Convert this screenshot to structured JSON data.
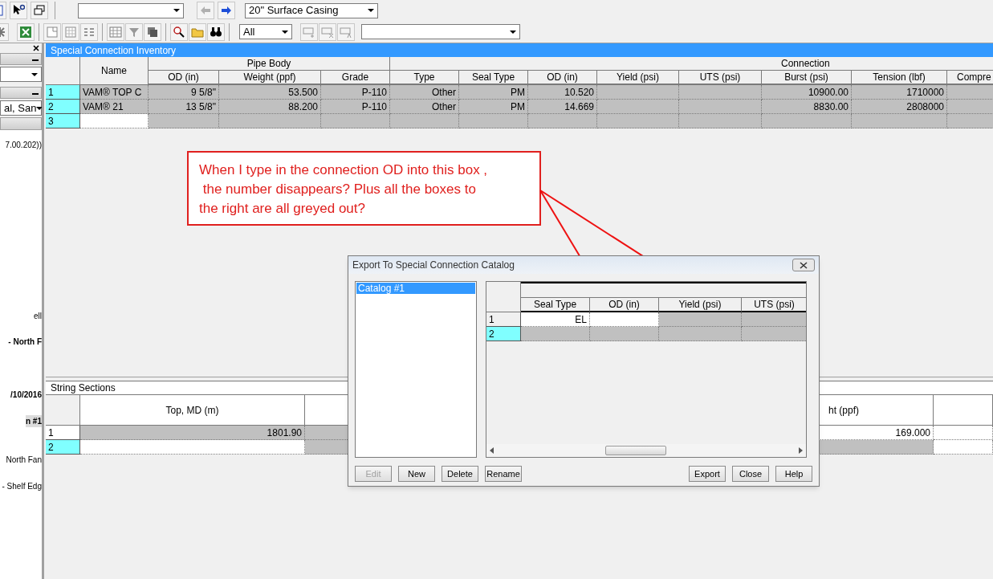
{
  "toolbar": {
    "casing_select": {
      "value": "20\" Surface Casing"
    },
    "filter_select": {
      "value": "All"
    }
  },
  "left_panel": {
    "project_select": {
      "value": "al, San"
    },
    "items": [
      {
        "text": "7.00.202))",
        "bold": false,
        "selected": false
      },
      {
        "text": "ell",
        "bold": false,
        "selected": false
      },
      {
        "text": "- North F",
        "bold": true,
        "selected": false
      },
      {
        "text": "/10/2016",
        "bold": true,
        "selected": false
      },
      {
        "text": "n #1",
        "bold": true,
        "selected": true
      },
      {
        "text": "North Fan",
        "bold": false,
        "selected": false
      },
      {
        "text": "- Shelf Edg",
        "bold": false,
        "selected": false
      }
    ]
  },
  "inventory": {
    "title": "Special Connection Inventory",
    "name_column": "Name",
    "groups": [
      "Pipe Body",
      "Connection"
    ],
    "columns": [
      "OD (in)",
      "Weight (ppf)",
      "Grade",
      "Type",
      "Seal Type",
      "OD (in)",
      "Yield (psi)",
      "UTS (psi)",
      "Burst (psi)",
      "Tension (lbf)",
      "Compre"
    ],
    "rows": [
      {
        "number": "1",
        "name": "VAM® TOP C",
        "name_editable": false,
        "cells": [
          "9 5/8\"",
          "53.500",
          "P-110",
          "Other",
          "PM",
          "10.520",
          null,
          null,
          "10900.00",
          "1710000",
          null
        ]
      },
      {
        "number": "2",
        "name": "VAM® 21",
        "name_editable": false,
        "cells": [
          "13 5/8\"",
          "88.200",
          "P-110",
          "Other",
          "PM",
          "14.669",
          null,
          null,
          "8830.00",
          "2808000",
          null
        ]
      },
      {
        "number": "3",
        "name_editable": true,
        "cells": [
          null,
          null,
          null,
          null,
          null,
          null,
          null,
          null,
          null,
          null,
          null
        ]
      }
    ]
  },
  "string_sections": {
    "title": "String Sections",
    "columns": [
      "Top, MD (m)",
      null,
      "ht (ppf)",
      null
    ],
    "rows": [
      {
        "number": "1",
        "selected": false,
        "cells": [
          {
            "text": "1801.90",
            "disabled": true
          },
          {
            "disabled": true
          },
          {
            "text": "169.000",
            "disabled": false
          },
          {
            "disabled": false
          }
        ]
      },
      {
        "number": "2",
        "selected": true,
        "cells": [
          {
            "disabled": false
          },
          {
            "disabled": true
          },
          {
            "disabled": true
          },
          {
            "disabled": false
          }
        ]
      }
    ]
  },
  "dialog": {
    "title": "Export To Special Connection Catalog",
    "catalogs": [
      {
        "label": "Catalog #1",
        "selected": true
      }
    ],
    "columns": [
      "Seal Type",
      "OD (in)",
      "Yield (psi)",
      "UTS (psi)"
    ],
    "rows": [
      {
        "number": "1",
        "selected": false,
        "cells": [
          {
            "text": "EL",
            "disabled": false
          },
          {
            "disabled": false
          },
          {
            "disabled": true
          },
          {
            "disabled": true
          }
        ]
      },
      {
        "number": "2",
        "selected": true,
        "cells": [
          {
            "disabled": true
          },
          {
            "disabled": true
          },
          {
            "disabled": true
          },
          {
            "disabled": true
          }
        ]
      }
    ],
    "left_buttons": [
      {
        "label": "Edit",
        "disabled": true
      },
      {
        "label": "New",
        "disabled": false
      },
      {
        "label": "Delete",
        "disabled": false
      },
      {
        "label": "Rename",
        "disabled": false
      }
    ],
    "right_buttons": [
      {
        "label": "Export",
        "disabled": false
      },
      {
        "label": "Close",
        "disabled": false
      },
      {
        "label": "Help",
        "disabled": false
      }
    ]
  },
  "callout": {
    "lines": [
      "When I type in the connection OD into this box ,",
      " the number disappears? Plus all the boxes to",
      "the right are all greyed out?"
    ]
  }
}
